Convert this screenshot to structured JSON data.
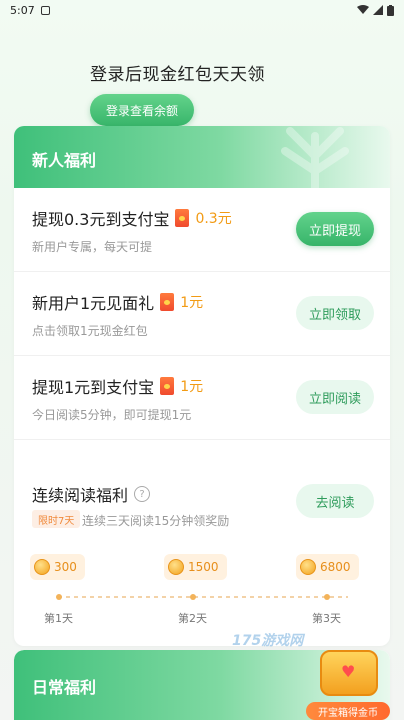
{
  "status_bar": {
    "time": "5:07"
  },
  "hero": {
    "title": "登录后现金红包天天领",
    "button_label": "登录查看余额"
  },
  "new_user": {
    "title": "新人福利",
    "tasks": [
      {
        "name": "提现0.3元到支付宝",
        "amount": "0.3元",
        "desc": "新用户专属，每天可提",
        "button": "立即提现"
      },
      {
        "name": "新用户1元见面礼",
        "amount": "1元",
        "desc": "点击领取1元现金红包",
        "button": "立即领取"
      },
      {
        "name": "提现1元到支付宝",
        "amount": "1元",
        "desc": "今日阅读5分钟，即可提现1元",
        "button": "立即阅读"
      }
    ],
    "continuous": {
      "name": "连续阅读福利",
      "badge": "限时7天",
      "desc": "连续三天阅读15分钟领奖励",
      "button": "去阅读",
      "rewards": [
        {
          "coins": "300",
          "day": "第1天"
        },
        {
          "coins": "1500",
          "day": "第2天"
        },
        {
          "coins": "6800",
          "day": "第3天"
        }
      ]
    }
  },
  "daily": {
    "title": "日常福利"
  },
  "treasure": {
    "label": "开宝箱得金币"
  },
  "watermark": "175游戏网",
  "colors": {
    "accent_green": "#38b56a",
    "coin_orange": "#f29b15"
  }
}
